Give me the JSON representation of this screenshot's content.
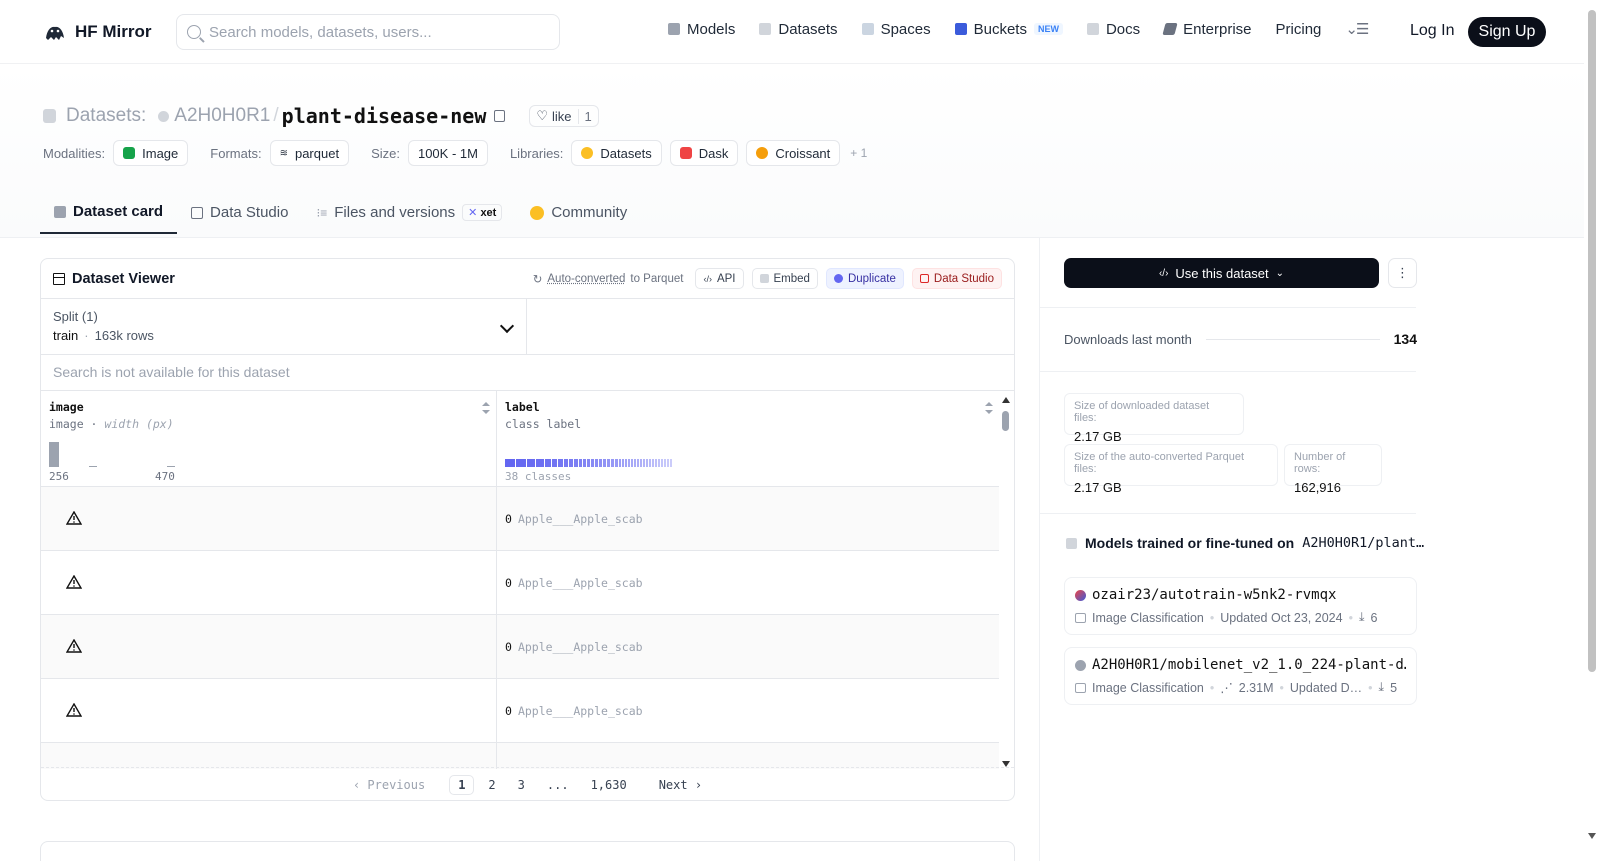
{
  "nav": {
    "brand": "HF Mirror",
    "search_placeholder": "Search models, datasets, users...",
    "items": [
      "Models",
      "Datasets",
      "Spaces",
      "Buckets",
      "Docs",
      "Enterprise",
      "Pricing"
    ],
    "new_badge": "NEW",
    "login": "Log In",
    "signup": "Sign Up"
  },
  "repo": {
    "kind_label": "Datasets:",
    "org": "A2H0H0R1",
    "name": "plant-disease-new",
    "like_label": "like",
    "likes": "1"
  },
  "meta": {
    "modalities_label": "Modalities:",
    "modalities": [
      "Image"
    ],
    "formats_label": "Formats:",
    "formats": [
      "parquet"
    ],
    "size_label": "Size:",
    "size": "100K - 1M",
    "libraries_label": "Libraries:",
    "libraries": [
      "Datasets",
      "Dask",
      "Croissant"
    ],
    "more": "+ 1"
  },
  "tabs": {
    "dataset_card": "Dataset card",
    "data_studio": "Data Studio",
    "files": "Files and versions",
    "xet": "xet",
    "community": "Community"
  },
  "viewer": {
    "title": "Dataset Viewer",
    "auto_converted": "Auto-converted",
    "to_parquet": "to Parquet",
    "api": "API",
    "embed": "Embed",
    "duplicate": "Duplicate",
    "data_studio": "Data Studio",
    "split_label": "Split (1)",
    "split_value": "train",
    "split_rows": "163k rows",
    "search_disabled": "Search is not available for this dataset",
    "columns": [
      {
        "name": "image",
        "type": "image",
        "type_note": "width (px)",
        "min": "256",
        "max": "470"
      },
      {
        "name": "label",
        "type": "class label",
        "classes": "38 classes"
      }
    ],
    "rows": [
      {
        "label_index": "0",
        "label_name": "Apple___Apple_scab"
      },
      {
        "label_index": "0",
        "label_name": "Apple___Apple_scab"
      },
      {
        "label_index": "0",
        "label_name": "Apple___Apple_scab"
      },
      {
        "label_index": "0",
        "label_name": "Apple___Apple_scab"
      }
    ],
    "pager": {
      "prev": "Previous",
      "pages": [
        "1",
        "2",
        "3",
        "...",
        "1,630"
      ],
      "next": "Next",
      "current": "1"
    }
  },
  "sidebar": {
    "use_button": "Use this dataset",
    "downloads_label": "Downloads last month",
    "downloads": "134",
    "stats": [
      {
        "label": "Size of downloaded dataset files:",
        "value": "2.17 GB"
      },
      {
        "label": "Size of the auto-converted Parquet files:",
        "value": "2.17 GB"
      },
      {
        "label": "Number of rows:",
        "value": "162,916"
      }
    ],
    "models_title": "Models trained or fine-tuned on",
    "models_repo": "A2H0H0R1/plant…",
    "models": [
      {
        "name": "ozair23/autotrain-w5nk2-rvmqx",
        "task": "Image Classification",
        "updated": "Updated Oct 23, 2024",
        "downloads": "6",
        "dot": "#3b5bdb"
      },
      {
        "name": "A2H0H0R1/mobilenet_v2_1.0_224-plant-d…",
        "task": "Image Classification",
        "params": "2.31M",
        "updated": "Updated D…",
        "downloads": "5",
        "dot": "#9ca3af"
      }
    ]
  },
  "colors": {
    "primary_dark": "#0b0f19",
    "accent_indigo": "#6366f1"
  }
}
